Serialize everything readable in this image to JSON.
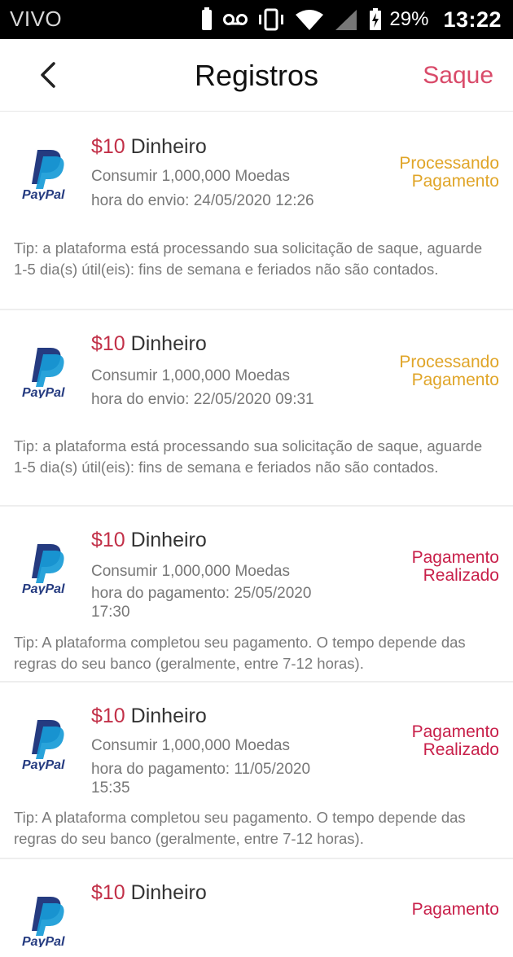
{
  "status_bar": {
    "carrier": "VIVO",
    "battery_percent": "29%",
    "time": "13:22"
  },
  "header": {
    "title": "Registros",
    "action_label": "Saque"
  },
  "colors": {
    "accent": "#d94b6a",
    "amount": "#c23048",
    "processing": "#e0a528",
    "done": "#c8204a",
    "paypal_dark": "#253b80",
    "paypal_light": "#179bd7"
  },
  "records": [
    {
      "amount": "$10",
      "amount_label": "Dinheiro",
      "coins": "Consumir 1,000,000 Moedas",
      "time": "hora do envio: 24/05/2020 12:26",
      "status_line1": "Processando",
      "status_line2": "Pagamento",
      "tip": "Tip: a plataforma está processando sua solicitação de saque, aguarde 1-5 dia(s) útil(eis): fins de semana e feriados não são contados.",
      "logo_label": "PayPal"
    },
    {
      "amount": "$10",
      "amount_label": "Dinheiro",
      "coins": "Consumir 1,000,000 Moedas",
      "time": "hora do envio: 22/05/2020 09:31",
      "status_line1": "Processando",
      "status_line2": "Pagamento",
      "tip": "Tip: a plataforma está processando sua solicitação de saque, aguarde 1-5 dia(s) útil(eis): fins de semana e feriados não são contados.",
      "logo_label": "PayPal"
    },
    {
      "amount": "$10",
      "amount_label": "Dinheiro",
      "coins": "Consumir 1,000,000 Moedas",
      "time": "hora do pagamento: 25/05/2020 17:30",
      "status_line1": "Pagamento",
      "status_line2": "Realizado",
      "tip": "Tip: A plataforma completou seu pagamento. O tempo depende das regras do seu banco (geralmente, entre 7-12 horas).",
      "logo_label": "PayPal"
    },
    {
      "amount": "$10",
      "amount_label": "Dinheiro",
      "coins": "Consumir 1,000,000 Moedas",
      "time": "hora do pagamento: 11/05/2020 15:35",
      "status_line1": "Pagamento",
      "status_line2": "Realizado",
      "tip": "Tip: A plataforma completou seu pagamento. O tempo depende das regras do seu banco (geralmente, entre 7-12 horas).",
      "logo_label": "PayPal"
    },
    {
      "amount": "$10",
      "amount_label": "Dinheiro",
      "status_line1": "Pagamento",
      "logo_label": "PayPal"
    }
  ],
  "icons": {
    "back": "chevron-left-icon",
    "paypal": "paypal-logo-icon"
  }
}
